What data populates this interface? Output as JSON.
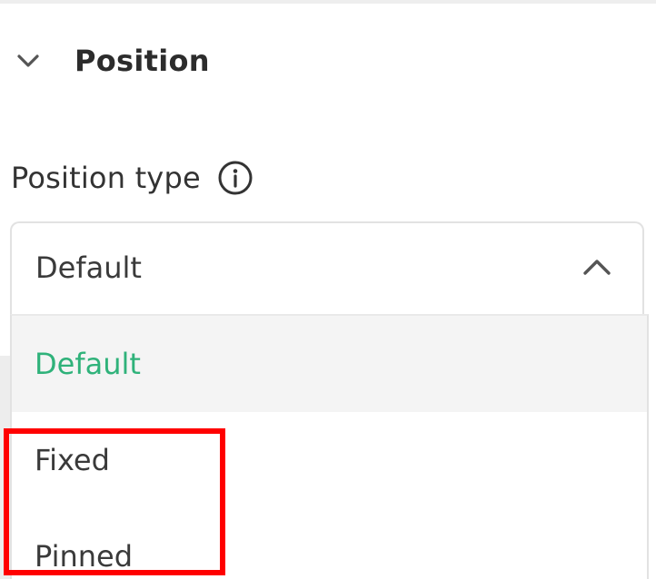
{
  "section": {
    "title": "Position",
    "icon": "chevron-down-icon"
  },
  "field": {
    "label": "Position type",
    "info_icon": "info-icon"
  },
  "select": {
    "value": "Default",
    "caret_icon": "chevron-up-icon",
    "expanded": true
  },
  "menu": {
    "options": [
      {
        "label": "Default",
        "selected": true
      },
      {
        "label": "Fixed",
        "selected": false
      },
      {
        "label": "Pinned",
        "selected": false
      }
    ]
  },
  "colors": {
    "selected_text": "#2fb27a",
    "highlight": "#ff0000",
    "border": "#e2e2e2"
  }
}
